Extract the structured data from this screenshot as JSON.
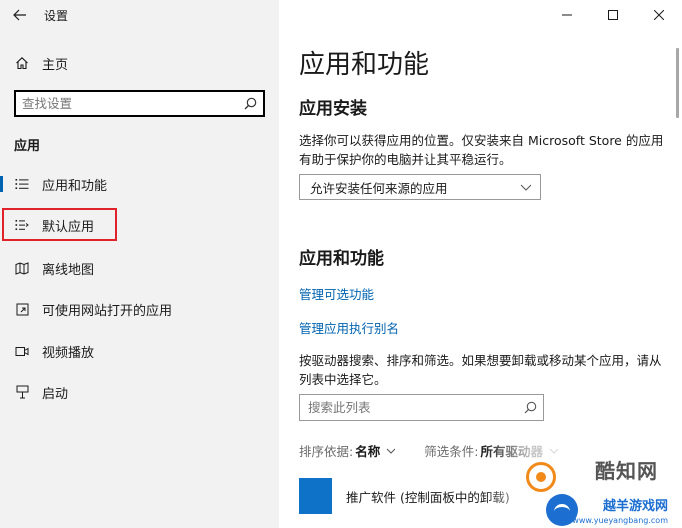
{
  "window": {
    "title": "设置"
  },
  "sidebar": {
    "home_label": "主页",
    "search_placeholder": "查找设置",
    "section_title": "应用",
    "items": [
      {
        "label": "应用和功能",
        "icon": "apps-list-icon",
        "active": true
      },
      {
        "label": "默认应用",
        "icon": "default-apps-icon",
        "active": false
      },
      {
        "label": "离线地图",
        "icon": "offline-map-icon",
        "active": false
      },
      {
        "label": "可使用网站打开的应用",
        "icon": "apps-for-websites-icon",
        "active": false
      },
      {
        "label": "视频播放",
        "icon": "video-playback-icon",
        "active": false
      },
      {
        "label": "启动",
        "icon": "startup-icon",
        "active": false
      }
    ]
  },
  "main": {
    "title": "应用和功能",
    "install_section": {
      "heading": "应用安装",
      "description": "选择你可以获得应用的位置。仅安装来自 Microsoft Store 的应用有助于保护你的电脑并让其平稳运行。",
      "dropdown_value": "允许安装任何来源的应用"
    },
    "features_section": {
      "heading": "应用和功能",
      "link_optional_features": "管理可选功能",
      "link_exec_aliases": "管理应用执行别名",
      "description": "按驱动器搜索、排序和筛选。如果想要卸载或移动某个应用，请从列表中选择它。",
      "list_search_placeholder": "搜索此列表",
      "sort_label": "排序依据:",
      "sort_value": "名称",
      "filter_label": "筛选条件:",
      "filter_value": "所有驱动器"
    },
    "app_list": [
      {
        "name": "推广软件 (控制面板中的卸载)"
      }
    ]
  },
  "watermark": {
    "brand_cn": "酷知网",
    "brand_cn2": "越羊游戏网",
    "url": "www.yueyangbang.com"
  },
  "colors": {
    "accent": "#0063b1",
    "sidebar_bg": "#f2f2f2",
    "highlight_border": "#e0232b",
    "app_tile": "#0e72c9"
  }
}
